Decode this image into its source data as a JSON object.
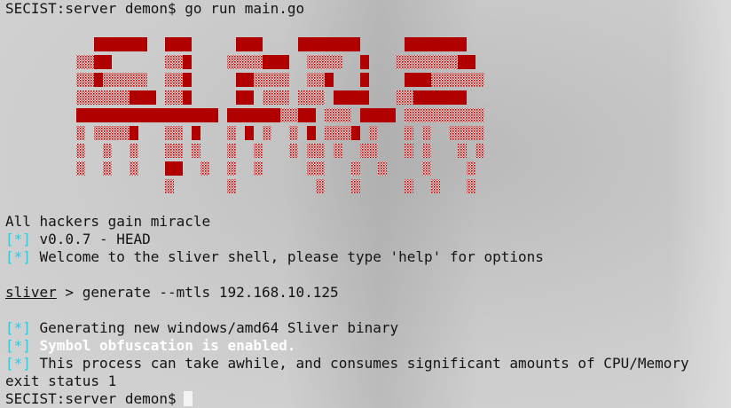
{
  "terminal": {
    "prompt_command": "SECIST:server demon$ go run main.go",
    "banner_word": "SLIVER",
    "tagline": "All hackers gain miracle",
    "version_tag": "[*]",
    "version_text": " v0.0.7 - HEAD",
    "welcome_tag": "[*]",
    "welcome_text": " Welcome to the sliver shell, please type 'help' for options",
    "sliver_prompt_name": "sliver",
    "sliver_prompt_rest": " > generate --mtls 192.168.10.125",
    "gen_tag": "[*]",
    "gen_text": " Generating new windows/amd64 Sliver binary",
    "obf_tag": "[*]",
    "obf_text": " Symbol obfuscation is enabled.",
    "process_tag": "[*]",
    "process_text": " This process can take awhile, and consumes significant amounts of CPU/Memory",
    "exit_text": "exit status 1",
    "final_prompt": "SECIST:server demon$"
  },
  "colors": {
    "banner_red": "#b00000",
    "tag_cyan": "#37c7d8",
    "text": "#141414",
    "cursor": "#f4f4f4"
  }
}
